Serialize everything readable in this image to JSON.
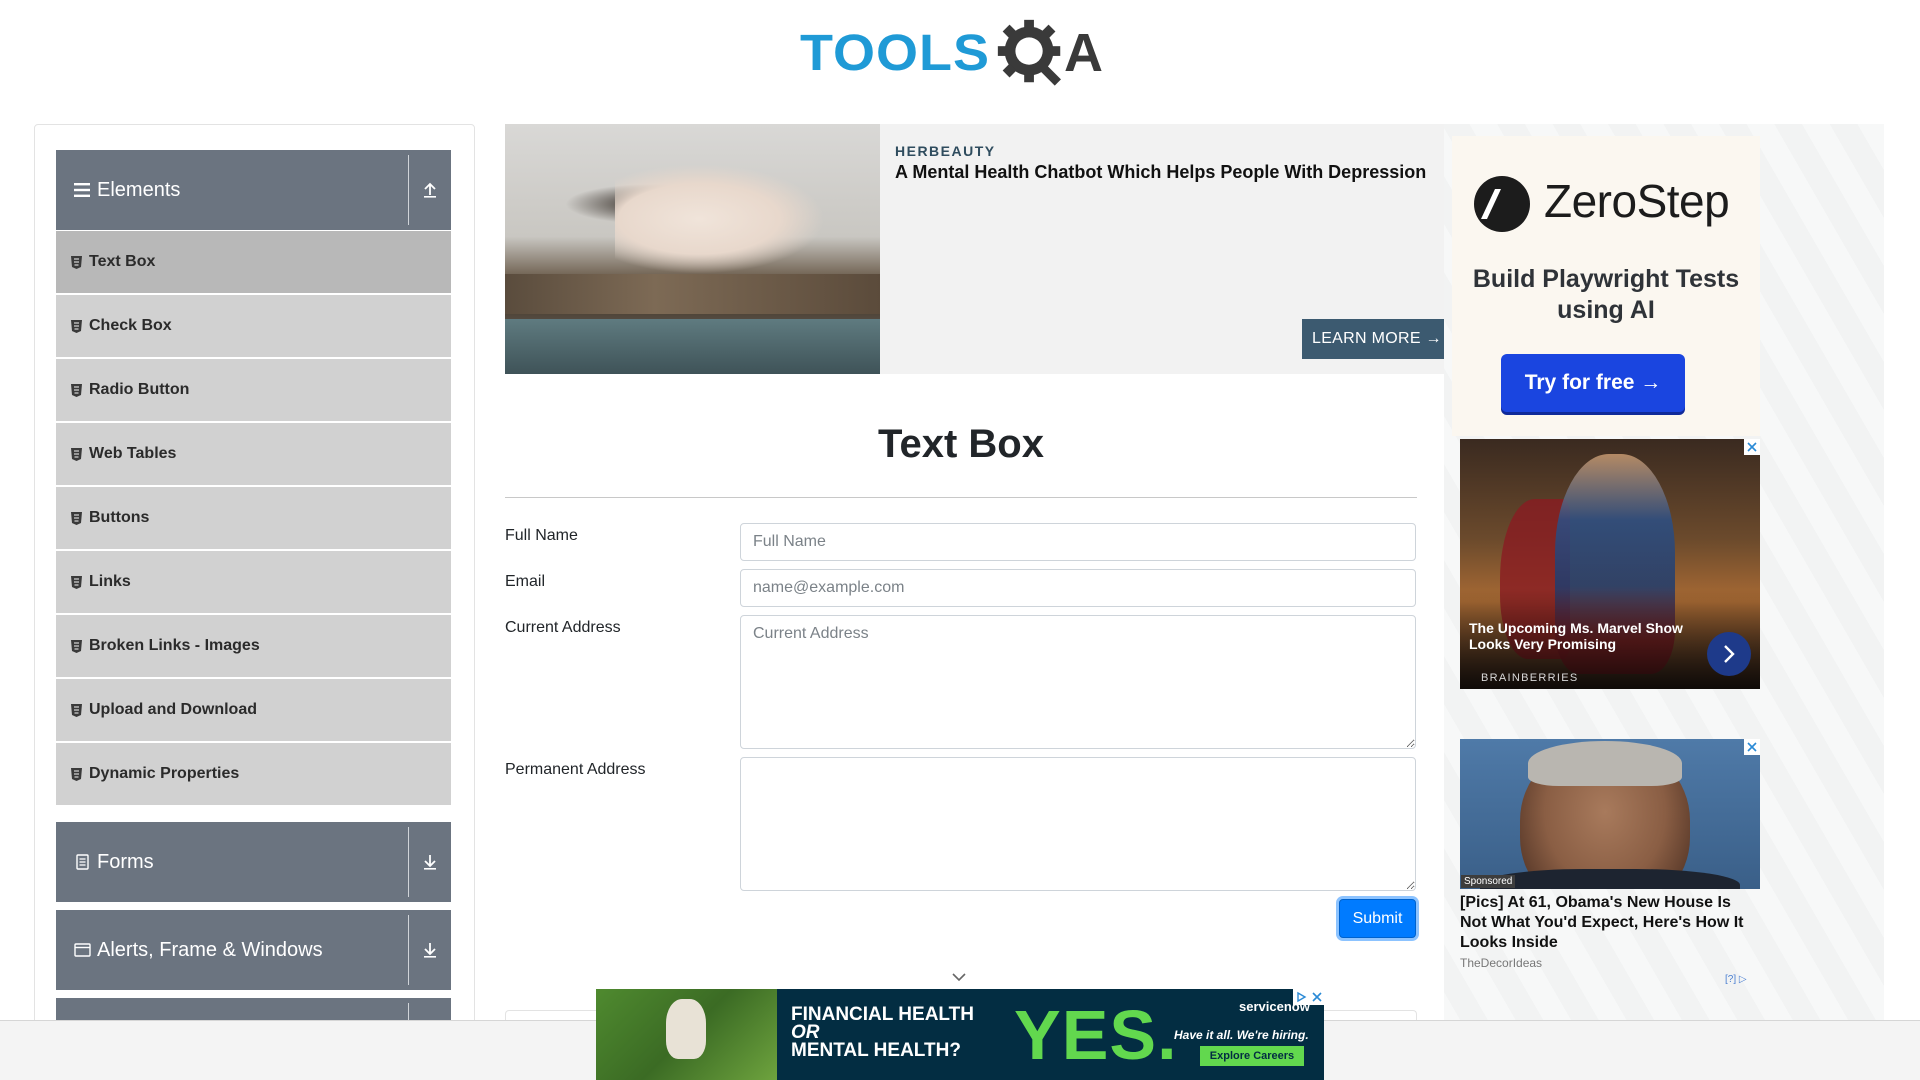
{
  "header": {
    "logo_text_left": "TOOLS",
    "logo_text_right": "A"
  },
  "sidebar": {
    "groups": [
      {
        "title": "Elements",
        "icon": "hamburger-icon",
        "state": "expanded"
      },
      {
        "title": "Forms",
        "icon": "document-icon",
        "state": "collapsed"
      },
      {
        "title": "Alerts, Frame & Windows",
        "icon": "window-icon",
        "state": "collapsed"
      }
    ],
    "items": [
      {
        "label": "Text Box",
        "active": true
      },
      {
        "label": "Check Box"
      },
      {
        "label": "Radio Button"
      },
      {
        "label": "Web Tables"
      },
      {
        "label": "Buttons"
      },
      {
        "label": "Links"
      },
      {
        "label": "Broken Links - Images"
      },
      {
        "label": "Upload and Download"
      },
      {
        "label": "Dynamic Properties"
      }
    ]
  },
  "top_ad": {
    "source": "HERBEAUTY",
    "headline": "A Mental Health Chatbot Which Helps People With Depression",
    "cta": "LEARN MORE →"
  },
  "form": {
    "title": "Text Box",
    "full_name": {
      "label": "Full Name",
      "placeholder": "Full Name",
      "value": ""
    },
    "email": {
      "label": "Email",
      "placeholder": "name@example.com",
      "value": ""
    },
    "current_address": {
      "label": "Current Address",
      "placeholder": "Current Address",
      "value": ""
    },
    "permanent_address": {
      "label": "Permanent Address",
      "placeholder": "",
      "value": ""
    },
    "submit_label": "Submit"
  },
  "right_ads": {
    "zerostep": {
      "brand": "ZeroStep",
      "tagline": "Build Playwright Tests using AI",
      "cta": "Try for free →"
    },
    "marvel": {
      "headline": "The Upcoming Ms. Marvel Show Looks Very Promising",
      "source": "BRAINBERRIES"
    },
    "obama": {
      "badge": "Sponsored",
      "headline": "[Pics] At 61, Obama's New House Is Not What You'd Expect, Here's How It Looks Inside",
      "source": "TheDecorIdeas",
      "adchoices": "[?]"
    }
  },
  "bottom_ad": {
    "line1": "FINANCIAL HEALTH",
    "line2": "OR",
    "line3": "MENTAL HEALTH?",
    "big": "YES.",
    "brand": "servicenow",
    "sub": "Have it all. We're hiring.",
    "cta": "Explore Careers"
  },
  "colors": {
    "brand_blue": "#1f9ad6",
    "sidebar_header": "#6b7480",
    "sidebar_item": "#d1d1d1",
    "sidebar_item_active": "#b8b8b8",
    "submit": "#007bff"
  }
}
